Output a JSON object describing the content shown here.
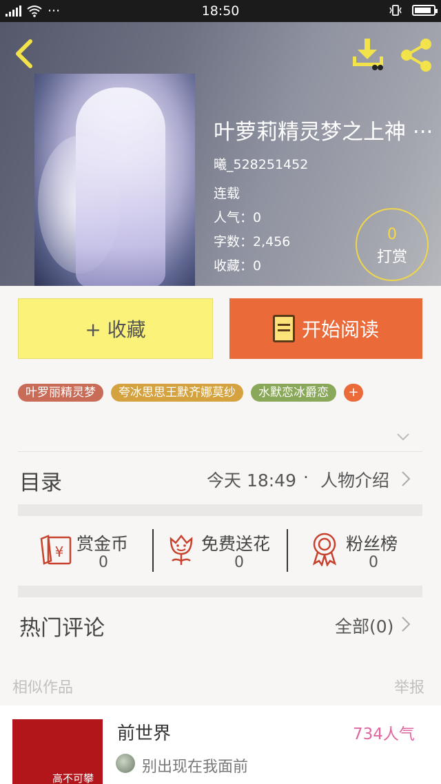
{
  "status_bar": {
    "network": "4G",
    "time": "18:50",
    "more": "···"
  },
  "book": {
    "title": "叶萝莉精灵梦之上神 ···",
    "author": "曦_528251452",
    "status": "连载",
    "popularity": "人气：0",
    "word_count": "字数：2,456",
    "favorites": "收藏：0"
  },
  "reward": {
    "count": "0",
    "label": "打赏"
  },
  "actions": {
    "favorite_label": "+ 收藏",
    "read_label": "开始阅读"
  },
  "tags": [
    {
      "label": "叶罗丽精灵梦",
      "color": "#c86b57"
    },
    {
      "label": "夸冰思思王默齐娜莫纱",
      "color": "#d4a23e"
    },
    {
      "label": "水默恋冰爵恋",
      "color": "#8aa859"
    }
  ],
  "tag_add": "+",
  "toc": {
    "title": "目录",
    "updated": "今天 18:49",
    "separator": "·",
    "characters": "人物介绍"
  },
  "stats": [
    {
      "label": "赏金币",
      "value": "0",
      "icon": "red-envelope-icon"
    },
    {
      "label": "免费送花",
      "value": "0",
      "icon": "flower-icon"
    },
    {
      "label": "粉丝榜",
      "value": "0",
      "icon": "medal-icon"
    }
  ],
  "comments": {
    "title": "热门评论",
    "all_label": "全部(0)"
  },
  "similar": {
    "title": "相似作品",
    "report": "举报"
  },
  "recommendation": {
    "title": "前世界",
    "popularity": "734人气",
    "description": "别出现在我面前",
    "cover_text": "高不可攀"
  },
  "colors": {
    "accent_orange": "#eb6a3a",
    "favorite_yellow": "#fbf27a",
    "reward_gold": "#f0d64a",
    "popularity_pink": "#e066a0"
  }
}
